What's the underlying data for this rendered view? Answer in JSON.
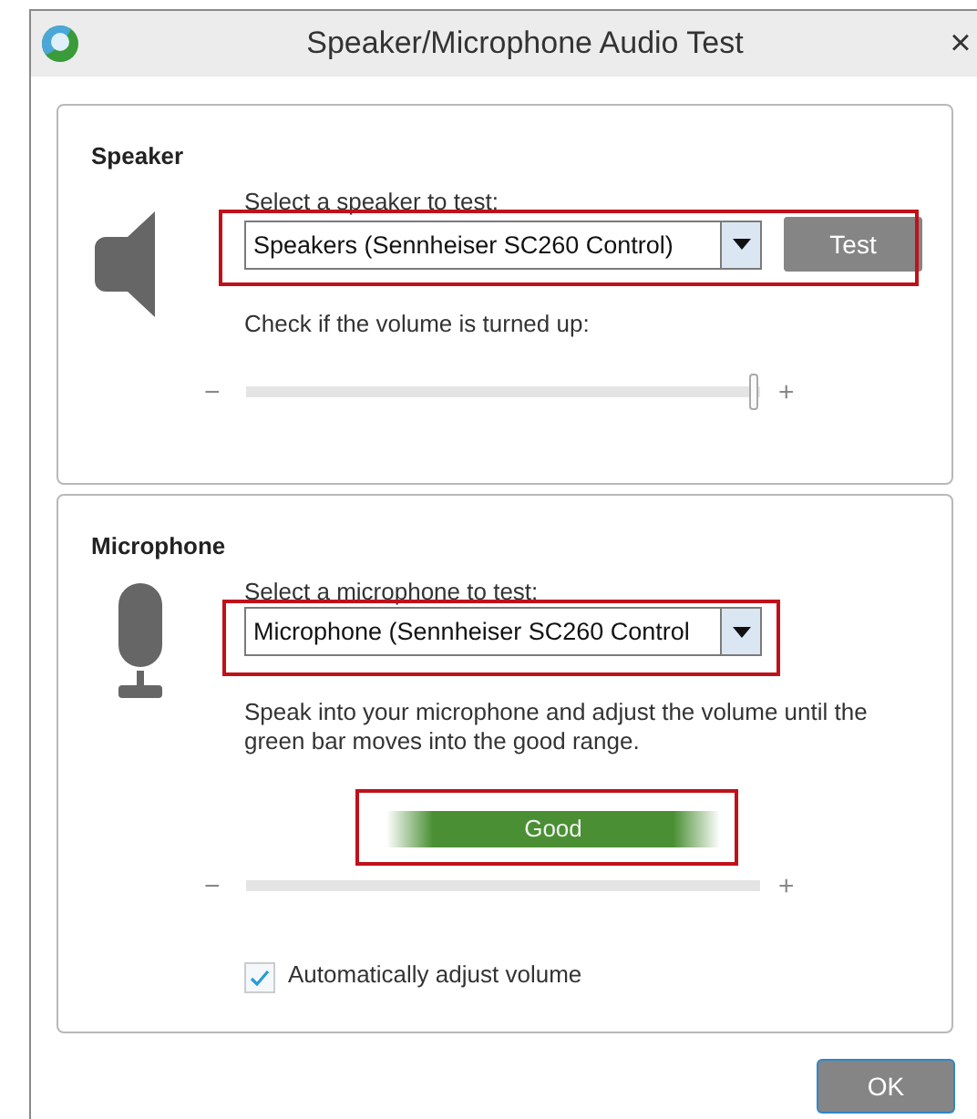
{
  "window": {
    "title": "Speaker/Microphone Audio Test",
    "close": "×"
  },
  "speaker": {
    "heading": "Speaker",
    "select_label": "Select a speaker to test:",
    "select_value": "Speakers (Sennheiser SC260 Control)",
    "select_annotated": true,
    "test_button": "Test",
    "volume_label": "Check if the volume is turned up:",
    "slider": {
      "minus": "−",
      "plus": "+",
      "level": 1,
      "thumb": true
    }
  },
  "microphone": {
    "heading": "Microphone",
    "select_label": "Select a microphone to test:",
    "select_value": "Microphone (Sennheiser SC260 Control",
    "select_annotated": true,
    "instructions": "Speak into your microphone and adjust the volume until the green bar moves into the good range.",
    "meter": {
      "label": "Good",
      "annotated": true
    },
    "slider": {
      "minus": "−",
      "plus": "+",
      "thumb": false
    },
    "auto_adjust": {
      "label": "Automatically adjust volume",
      "checked": true
    }
  },
  "buttons": [
    {
      "label": "OK"
    }
  ]
}
